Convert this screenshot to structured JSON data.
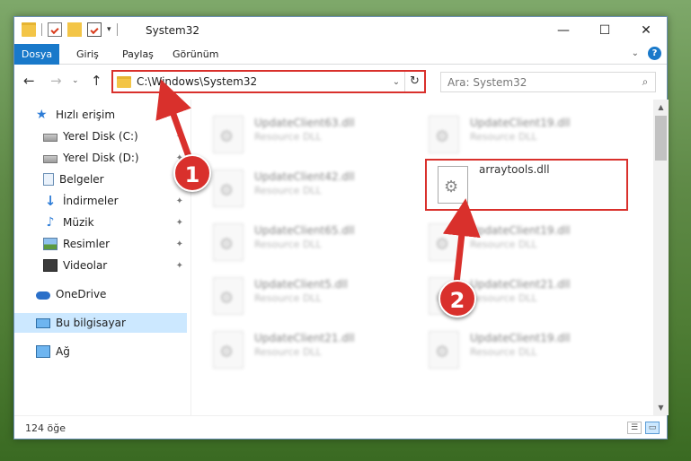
{
  "window": {
    "title": "System32",
    "controls": {
      "minimize": "—",
      "maximize": "☐",
      "close": "✕"
    },
    "quick_access_dropdown": "▾"
  },
  "ribbon": {
    "tabs": [
      "Dosya",
      "Giriş",
      "Paylaş",
      "Görünüm"
    ],
    "collapse_icon": "chevron-down-icon",
    "help_label": "?"
  },
  "address": {
    "path": "C:\\Windows\\System32",
    "dropdown": "⌄",
    "refresh": "↻"
  },
  "search": {
    "placeholder": "Ara: System32",
    "icon": "⌕"
  },
  "navigation": {
    "back": "←",
    "forward": "→",
    "recent": "⌄",
    "up": "↑"
  },
  "sidebar": {
    "items": [
      {
        "label": "Hızlı erişim",
        "icon": "star-icon",
        "pinned": false
      },
      {
        "label": "Yerel Disk (C:)",
        "icon": "drive-icon",
        "pinned": true
      },
      {
        "label": "Yerel Disk (D:)",
        "icon": "drive-icon",
        "pinned": true
      },
      {
        "label": "Belgeler",
        "icon": "documents-icon",
        "pinned": true
      },
      {
        "label": "İndirmeler",
        "icon": "download-icon",
        "pinned": true
      },
      {
        "label": "Müzik",
        "icon": "music-icon",
        "pinned": true
      },
      {
        "label": "Resimler",
        "icon": "pictures-icon",
        "pinned": true
      },
      {
        "label": "Videolar",
        "icon": "videos-icon",
        "pinned": true
      },
      {
        "label": "OneDrive",
        "icon": "onedrive-icon",
        "pinned": false
      },
      {
        "label": "Bu bilgisayar",
        "icon": "computer-icon",
        "pinned": false,
        "selected": true
      },
      {
        "label": "Ağ",
        "icon": "network-icon",
        "pinned": false
      }
    ],
    "pin_glyph": "📌"
  },
  "files": [
    {
      "name": "UpdateClient63.dll",
      "type": "Resource DLL"
    },
    {
      "name": "UpdateClient19.dll",
      "type": "Resource DLL"
    },
    {
      "name": "UpdateClient42.dll",
      "type": "Resource DLL"
    },
    {
      "name": "arraytools.dll",
      "type": "",
      "highlighted": true
    },
    {
      "name": "UpdateClient65.dll",
      "type": "Resource DLL"
    },
    {
      "name": "UpdateClient19.dll",
      "type": "Resource DLL"
    },
    {
      "name": "UpdateClient5.dll",
      "type": "Resource DLL"
    },
    {
      "name": "UpdateClient21.dll",
      "type": "Resource DLL"
    },
    {
      "name": "UpdateClient21.dll",
      "type": "Resource DLL"
    },
    {
      "name": "UpdateClient19.dll",
      "type": "Resource DLL"
    }
  ],
  "status": {
    "item_count": "124 öğe"
  },
  "callouts": {
    "step1": "1",
    "step2": "2",
    "color": "#d9302c"
  }
}
